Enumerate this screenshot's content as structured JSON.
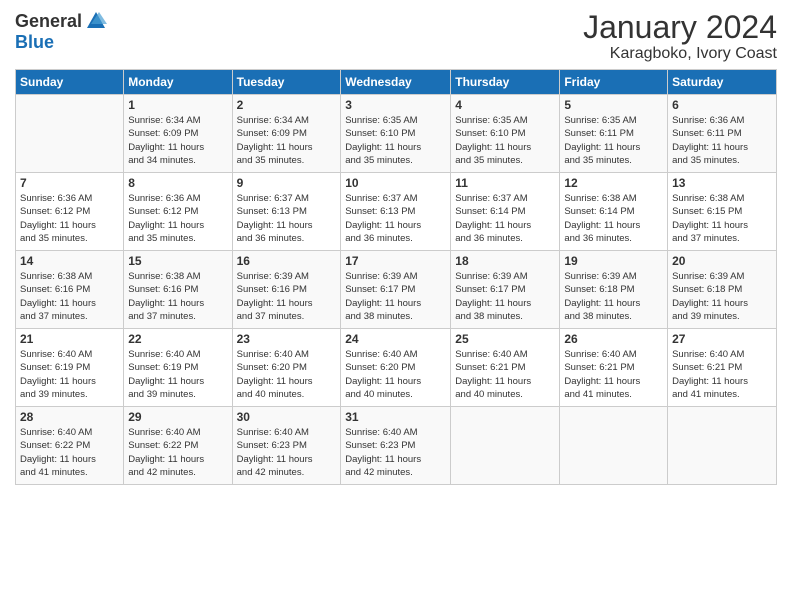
{
  "logo": {
    "general": "General",
    "blue": "Blue"
  },
  "header": {
    "month": "January 2024",
    "location": "Karagboko, Ivory Coast"
  },
  "days_header": [
    "Sunday",
    "Monday",
    "Tuesday",
    "Wednesday",
    "Thursday",
    "Friday",
    "Saturday"
  ],
  "weeks": [
    [
      {
        "day": "",
        "info": ""
      },
      {
        "day": "1",
        "info": "Sunrise: 6:34 AM\nSunset: 6:09 PM\nDaylight: 11 hours\nand 34 minutes."
      },
      {
        "day": "2",
        "info": "Sunrise: 6:34 AM\nSunset: 6:09 PM\nDaylight: 11 hours\nand 35 minutes."
      },
      {
        "day": "3",
        "info": "Sunrise: 6:35 AM\nSunset: 6:10 PM\nDaylight: 11 hours\nand 35 minutes."
      },
      {
        "day": "4",
        "info": "Sunrise: 6:35 AM\nSunset: 6:10 PM\nDaylight: 11 hours\nand 35 minutes."
      },
      {
        "day": "5",
        "info": "Sunrise: 6:35 AM\nSunset: 6:11 PM\nDaylight: 11 hours\nand 35 minutes."
      },
      {
        "day": "6",
        "info": "Sunrise: 6:36 AM\nSunset: 6:11 PM\nDaylight: 11 hours\nand 35 minutes."
      }
    ],
    [
      {
        "day": "7",
        "info": "Sunrise: 6:36 AM\nSunset: 6:12 PM\nDaylight: 11 hours\nand 35 minutes."
      },
      {
        "day": "8",
        "info": "Sunrise: 6:36 AM\nSunset: 6:12 PM\nDaylight: 11 hours\nand 35 minutes."
      },
      {
        "day": "9",
        "info": "Sunrise: 6:37 AM\nSunset: 6:13 PM\nDaylight: 11 hours\nand 36 minutes."
      },
      {
        "day": "10",
        "info": "Sunrise: 6:37 AM\nSunset: 6:13 PM\nDaylight: 11 hours\nand 36 minutes."
      },
      {
        "day": "11",
        "info": "Sunrise: 6:37 AM\nSunset: 6:14 PM\nDaylight: 11 hours\nand 36 minutes."
      },
      {
        "day": "12",
        "info": "Sunrise: 6:38 AM\nSunset: 6:14 PM\nDaylight: 11 hours\nand 36 minutes."
      },
      {
        "day": "13",
        "info": "Sunrise: 6:38 AM\nSunset: 6:15 PM\nDaylight: 11 hours\nand 37 minutes."
      }
    ],
    [
      {
        "day": "14",
        "info": "Sunrise: 6:38 AM\nSunset: 6:16 PM\nDaylight: 11 hours\nand 37 minutes."
      },
      {
        "day": "15",
        "info": "Sunrise: 6:38 AM\nSunset: 6:16 PM\nDaylight: 11 hours\nand 37 minutes."
      },
      {
        "day": "16",
        "info": "Sunrise: 6:39 AM\nSunset: 6:16 PM\nDaylight: 11 hours\nand 37 minutes."
      },
      {
        "day": "17",
        "info": "Sunrise: 6:39 AM\nSunset: 6:17 PM\nDaylight: 11 hours\nand 38 minutes."
      },
      {
        "day": "18",
        "info": "Sunrise: 6:39 AM\nSunset: 6:17 PM\nDaylight: 11 hours\nand 38 minutes."
      },
      {
        "day": "19",
        "info": "Sunrise: 6:39 AM\nSunset: 6:18 PM\nDaylight: 11 hours\nand 38 minutes."
      },
      {
        "day": "20",
        "info": "Sunrise: 6:39 AM\nSunset: 6:18 PM\nDaylight: 11 hours\nand 39 minutes."
      }
    ],
    [
      {
        "day": "21",
        "info": "Sunrise: 6:40 AM\nSunset: 6:19 PM\nDaylight: 11 hours\nand 39 minutes."
      },
      {
        "day": "22",
        "info": "Sunrise: 6:40 AM\nSunset: 6:19 PM\nDaylight: 11 hours\nand 39 minutes."
      },
      {
        "day": "23",
        "info": "Sunrise: 6:40 AM\nSunset: 6:20 PM\nDaylight: 11 hours\nand 40 minutes."
      },
      {
        "day": "24",
        "info": "Sunrise: 6:40 AM\nSunset: 6:20 PM\nDaylight: 11 hours\nand 40 minutes."
      },
      {
        "day": "25",
        "info": "Sunrise: 6:40 AM\nSunset: 6:21 PM\nDaylight: 11 hours\nand 40 minutes."
      },
      {
        "day": "26",
        "info": "Sunrise: 6:40 AM\nSunset: 6:21 PM\nDaylight: 11 hours\nand 41 minutes."
      },
      {
        "day": "27",
        "info": "Sunrise: 6:40 AM\nSunset: 6:21 PM\nDaylight: 11 hours\nand 41 minutes."
      }
    ],
    [
      {
        "day": "28",
        "info": "Sunrise: 6:40 AM\nSunset: 6:22 PM\nDaylight: 11 hours\nand 41 minutes."
      },
      {
        "day": "29",
        "info": "Sunrise: 6:40 AM\nSunset: 6:22 PM\nDaylight: 11 hours\nand 42 minutes."
      },
      {
        "day": "30",
        "info": "Sunrise: 6:40 AM\nSunset: 6:23 PM\nDaylight: 11 hours\nand 42 minutes."
      },
      {
        "day": "31",
        "info": "Sunrise: 6:40 AM\nSunset: 6:23 PM\nDaylight: 11 hours\nand 42 minutes."
      },
      {
        "day": "",
        "info": ""
      },
      {
        "day": "",
        "info": ""
      },
      {
        "day": "",
        "info": ""
      }
    ]
  ]
}
